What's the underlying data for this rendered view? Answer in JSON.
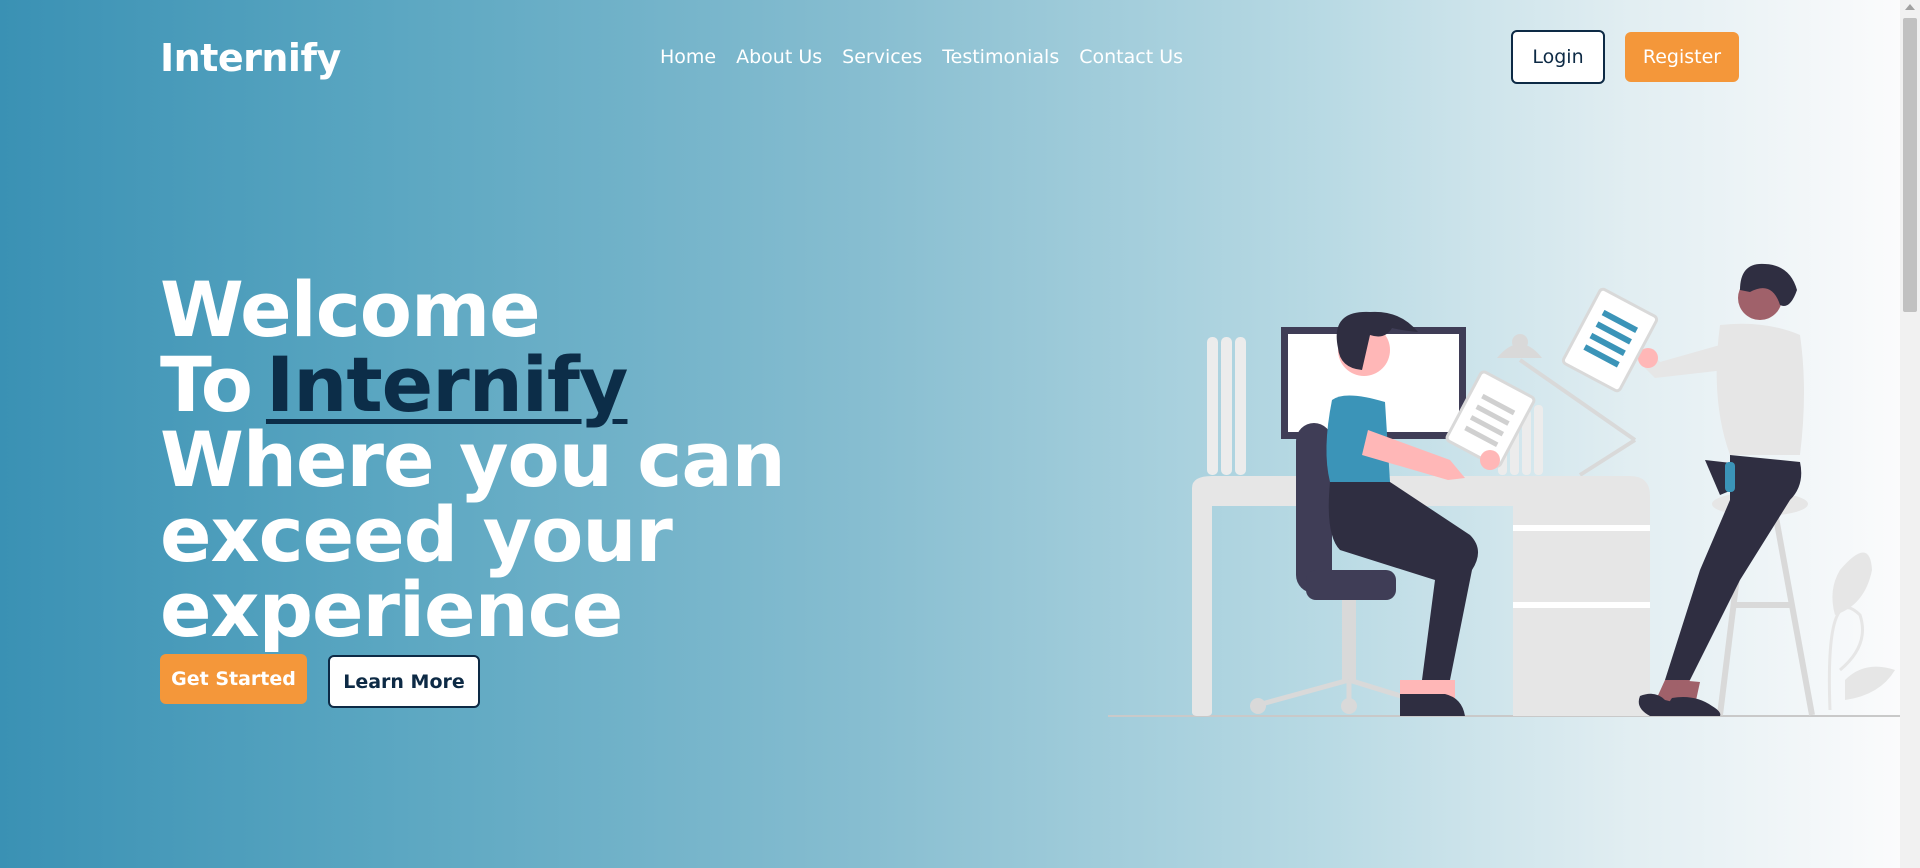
{
  "header": {
    "logo": "Internify",
    "nav": [
      "Home",
      "About Us",
      "Services",
      "Testimonials",
      "Contact Us"
    ],
    "login_label": "Login",
    "register_label": "Register"
  },
  "hero": {
    "title_prefix": "Welcome To",
    "title_brand": "Internify",
    "title_line2": "Where you can",
    "title_line3": "exceed your",
    "title_line4": "experience",
    "get_started_label": "Get Started",
    "learn_more_label": "Learn More"
  },
  "colors": {
    "accent": "#f4973a",
    "dark_navy": "#0d2a45",
    "gradient_start": "#3a91b4",
    "illustration_blue": "#3b94b8"
  },
  "illustration": "office-workers-illustration"
}
